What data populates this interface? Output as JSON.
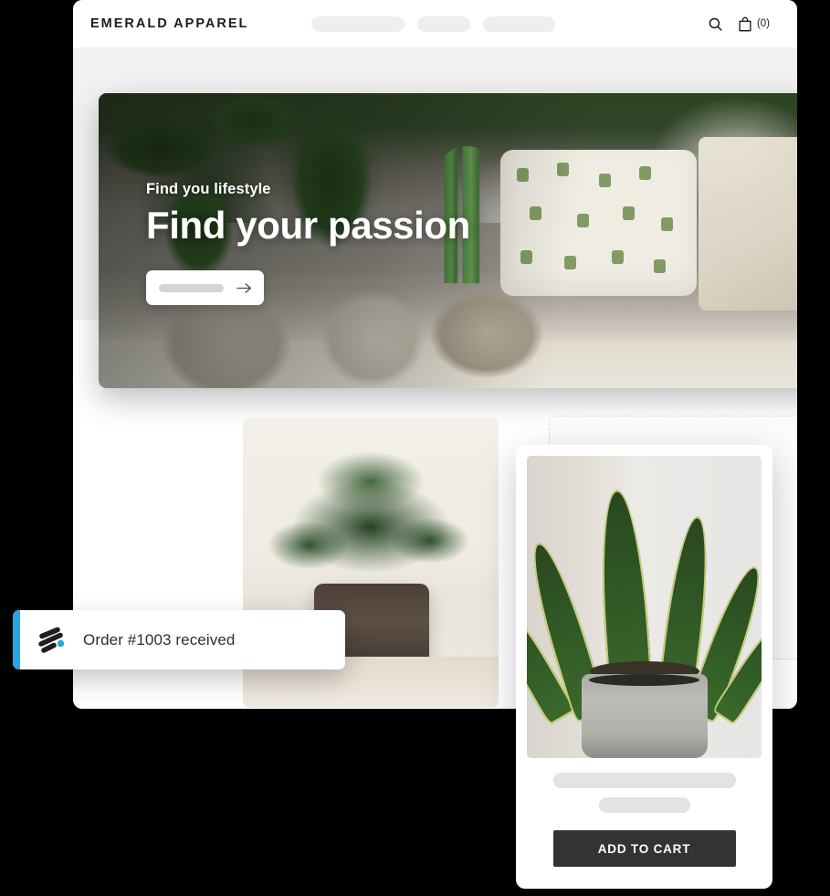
{
  "browser": {
    "header": {
      "brand": "EMERALD APPAREL",
      "nav_placeholders": [
        "",
        "",
        ""
      ],
      "search_icon": "search-icon",
      "cart_icon": "shopping-bag-icon",
      "cart_count": "(0)"
    }
  },
  "hero": {
    "eyebrow": "Find you lifestyle",
    "headline": "Find your passion",
    "search_placeholder": "",
    "arrow_icon": "arrow-right-icon"
  },
  "products": {
    "card": {
      "image_alt": "snake-plant-photo",
      "title_placeholder": "",
      "subtitle_placeholder": "",
      "add_to_cart_label": "ADD TO CART"
    },
    "left_tile": {
      "image_alt": "succulent-plant-photo"
    },
    "placeholder_tile": {
      "label": ""
    }
  },
  "toast": {
    "logo_icon": "app-logo-icon",
    "message": "Order #1003 received",
    "accent_color": "#2ba6dd"
  },
  "colors": {
    "page_background": "#000000",
    "browser_chrome": "#ffffff",
    "browser_body": "#f2f2f2",
    "button_dark": "#333333",
    "accent_cyan": "#2ba6dd",
    "placeholder_gray": "#e3e3e3"
  }
}
